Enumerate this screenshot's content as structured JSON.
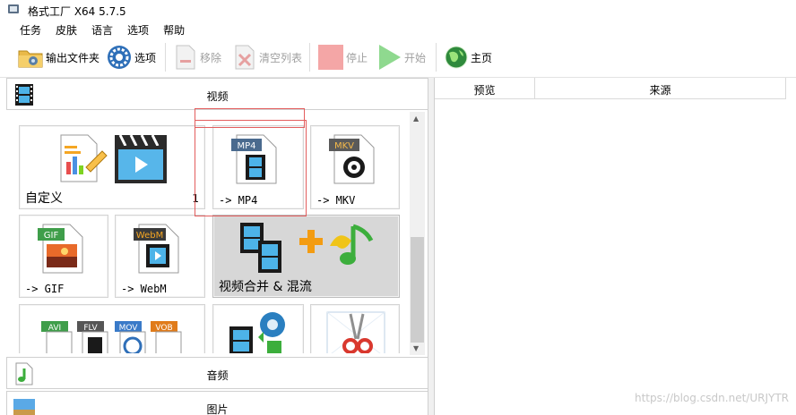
{
  "window": {
    "title": "格式工厂 X64 5.7.5"
  },
  "menu": [
    "任务",
    "皮肤",
    "语言",
    "选项",
    "帮助"
  ],
  "toolbar": {
    "output_folder": "输出文件夹",
    "options": "选项",
    "remove": "移除",
    "clear_list": "清空列表",
    "stop": "停止",
    "start": "开始",
    "home": "主页"
  },
  "categories": {
    "video": "视频",
    "audio": "音频",
    "image": "图片"
  },
  "tiles": {
    "custom": "自定义",
    "custom_count": "1",
    "mp4": "-> MP4",
    "mkv": "-> MKV",
    "gif": "-> GIF",
    "webm": "-> WebM",
    "merge": "视频合并 & 混流",
    "badges": {
      "mp4": "MP4",
      "mkv": "MKV",
      "gif": "GIF",
      "webm": "WebM",
      "avi": "AVI",
      "flv": "FLV",
      "mov": "MOV",
      "vob": "VOB"
    }
  },
  "table": {
    "columns": [
      "预览",
      "来源"
    ]
  },
  "watermark": "https://blog.csdn.net/URJYTR",
  "icons": [
    "app-icon",
    "folder-icon",
    "gear-icon",
    "remove-icon",
    "clear-list-icon",
    "stop-icon",
    "start-icon",
    "globe-icon",
    "video-film-icon",
    "music-note-icon",
    "picture-icon",
    "scissors-icon"
  ],
  "colors": {
    "stop": "#f4a6a6",
    "start": "#8fd98f",
    "highlight_box": "#e35d5d"
  }
}
